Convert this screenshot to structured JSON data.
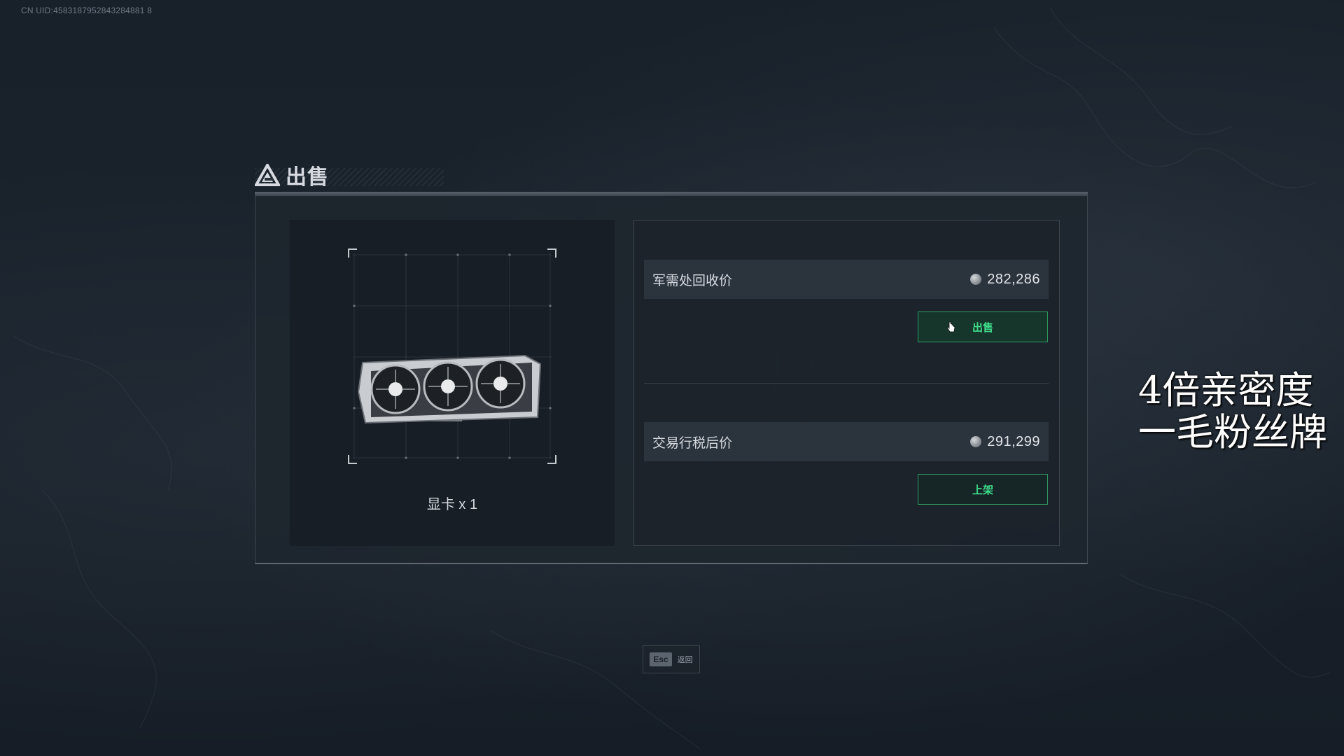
{
  "uid_text": "CN UID:4583187952843284881 8",
  "dialog": {
    "title": "出售",
    "item": {
      "name": "显卡 x 1",
      "image": "graphics-card"
    },
    "recycle": {
      "label": "军需处回收价",
      "value": "282,286",
      "button": "出售"
    },
    "market": {
      "label": "交易行税后价",
      "value": "291,299",
      "button": "上架"
    }
  },
  "esc_hint": {
    "key": "Esc",
    "label": "返回"
  },
  "overlay": {
    "line1": "4倍亲密度",
    "line2": "一毛粉丝牌"
  },
  "colors": {
    "accent_green": "#3fdf8c",
    "button_border": "#2f9a63",
    "background": "#141b24"
  }
}
